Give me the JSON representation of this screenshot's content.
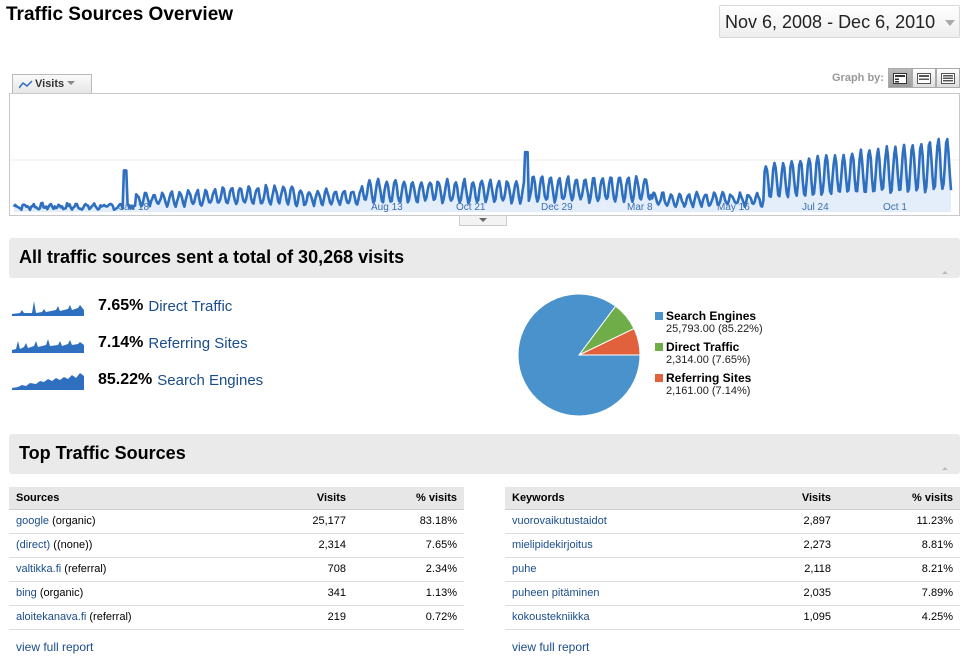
{
  "page": {
    "title": "Traffic Sources Overview"
  },
  "date_range": {
    "label": "Nov 6, 2008 - Dec 6, 2010"
  },
  "graph": {
    "metric_label": "Visits",
    "graph_by_label": "Graph by:",
    "y_ticks": [
      "200",
      "100"
    ],
    "x_ticks": [
      "Jan 18",
      "Aug 13",
      "Oct 21",
      "Dec 29",
      "Mar 8",
      "May 16",
      "Jul 24",
      "Oct 1"
    ],
    "y_max": 200,
    "colors": {
      "line": "#2f6fc0",
      "fill": "#e3eefa"
    }
  },
  "summary": {
    "heading": "All traffic sources sent a total of 30,268 visits",
    "sources": [
      {
        "percent": "7.65%",
        "label": "Direct Traffic"
      },
      {
        "percent": "7.14%",
        "label": "Referring Sites"
      },
      {
        "percent": "85.22%",
        "label": "Search Engines"
      }
    ]
  },
  "chart_data": {
    "type": "pie",
    "slices": [
      {
        "name": "Search Engines",
        "value": 25793,
        "value_label": "25,793.00 (85.22%)",
        "color": "#4a92cc"
      },
      {
        "name": "Direct Traffic",
        "value": 2314,
        "value_label": "2,314.00 (7.65%)",
        "color": "#6fad48"
      },
      {
        "name": "Referring Sites",
        "value": 2161,
        "value_label": "2,161.00 (7.14%)",
        "color": "#e0613b"
      }
    ]
  },
  "top_sources": {
    "heading": "Top Traffic Sources",
    "sources_table": {
      "headers": [
        "Sources",
        "Visits",
        "% visits"
      ],
      "rows": [
        {
          "name": "google",
          "suffix": "(organic)",
          "visits": "25,177",
          "pct": "83.18%"
        },
        {
          "name": "(direct)",
          "suffix": "((none))",
          "visits": "2,314",
          "pct": "7.65%"
        },
        {
          "name": "valtikka.fi",
          "suffix": "(referral)",
          "visits": "708",
          "pct": "2.34%"
        },
        {
          "name": "bing",
          "suffix": "(organic)",
          "visits": "341",
          "pct": "1.13%"
        },
        {
          "name": "aloitekanava.fi",
          "suffix": "(referral)",
          "visits": "219",
          "pct": "0.72%"
        }
      ],
      "full_report": "view full report"
    },
    "keywords_table": {
      "headers": [
        "Keywords",
        "Visits",
        "% visits"
      ],
      "rows": [
        {
          "name": "vuorovaikutustaidot",
          "visits": "2,897",
          "pct": "11.23%"
        },
        {
          "name": "mielipidekirjoitus",
          "visits": "2,273",
          "pct": "8.81%"
        },
        {
          "name": "puhe",
          "visits": "2,118",
          "pct": "8.21%"
        },
        {
          "name": "puheen pitäminen",
          "visits": "2,035",
          "pct": "7.89%"
        },
        {
          "name": "kokoustekniikka",
          "visits": "1,095",
          "pct": "4.25%"
        }
      ],
      "full_report": "view full report"
    }
  }
}
